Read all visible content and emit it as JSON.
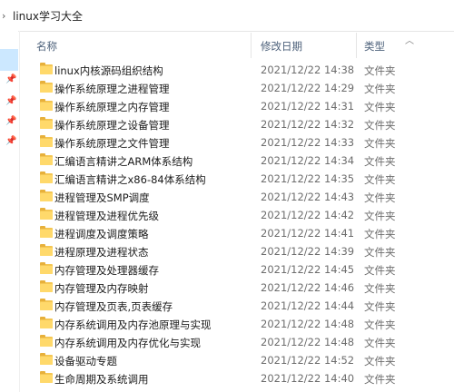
{
  "breadcrumb": {
    "label": "linux学习大全"
  },
  "columns": {
    "name": "名称",
    "date": "修改日期",
    "type": "类型"
  },
  "files": [
    {
      "name": "linux内核源码组织结构",
      "date": "2021/12/22 14:38",
      "type": "文件夹"
    },
    {
      "name": "操作系统原理之进程管理",
      "date": "2021/12/22 14:29",
      "type": "文件夹"
    },
    {
      "name": "操作系统原理之内存管理",
      "date": "2021/12/22 14:31",
      "type": "文件夹"
    },
    {
      "name": "操作系统原理之设备管理",
      "date": "2021/12/22 14:32",
      "type": "文件夹"
    },
    {
      "name": "操作系统原理之文件管理",
      "date": "2021/12/22 14:33",
      "type": "文件夹"
    },
    {
      "name": "汇编语言精讲之ARM体系结构",
      "date": "2021/12/22 14:34",
      "type": "文件夹"
    },
    {
      "name": "汇编语言精讲之x86-84体系结构",
      "date": "2021/12/22 14:35",
      "type": "文件夹"
    },
    {
      "name": "进程管理及SMP调度",
      "date": "2021/12/22 14:43",
      "type": "文件夹"
    },
    {
      "name": "进程管理及进程优先级",
      "date": "2021/12/22 14:42",
      "type": "文件夹"
    },
    {
      "name": "进程调度及调度策略",
      "date": "2021/12/22 14:41",
      "type": "文件夹"
    },
    {
      "name": "进程原理及进程状态",
      "date": "2021/12/22 14:39",
      "type": "文件夹"
    },
    {
      "name": "内存管理及处理器缓存",
      "date": "2021/12/22 14:45",
      "type": "文件夹"
    },
    {
      "name": "内存管理及内存映射",
      "date": "2021/12/22 14:46",
      "type": "文件夹"
    },
    {
      "name": "内存管理及页表,页表缓存",
      "date": "2021/12/22 14:44",
      "type": "文件夹"
    },
    {
      "name": "内存系统调用及内存池原理与实现",
      "date": "2021/12/22 14:48",
      "type": "文件夹"
    },
    {
      "name": "内存系统调用及内存优化与实现",
      "date": "2021/12/22 14:48",
      "type": "文件夹"
    },
    {
      "name": "设备驱动专题",
      "date": "2021/12/22 14:52",
      "type": "文件夹"
    },
    {
      "name": "生命周期及系统调用",
      "date": "2021/12/22 14:40",
      "type": "文件夹"
    }
  ]
}
